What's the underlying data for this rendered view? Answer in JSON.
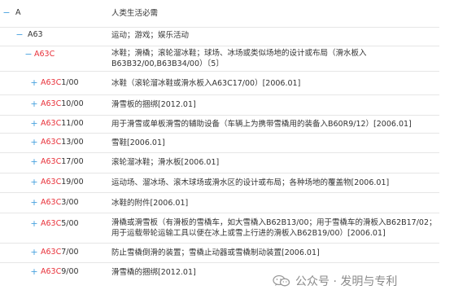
{
  "rows": [
    {
      "toggle": "−",
      "code_hl": "",
      "code_rest": "A",
      "desc": "人类生活必需"
    },
    {
      "toggle": "−",
      "code_hl": "",
      "code_rest": "A63",
      "desc": "运动；游戏；娱乐活动"
    },
    {
      "toggle": "−",
      "code_hl": "A63C",
      "code_rest": "",
      "desc": "冰鞋；滑橇；滚轮溜冰鞋；球场、冰场或类似场地的设计或布局（滑水板入B63B32/00,B63B34/00）〔5〕"
    },
    {
      "toggle": "+",
      "code_hl": "A63C",
      "code_rest": "1/00",
      "desc": "冰鞋（滚轮溜冰鞋或滑水板入A63C17/00）[2006.01]"
    },
    {
      "toggle": "+",
      "code_hl": "A63C",
      "code_rest": "10/00",
      "desc": "滑雪板的捆绑[2012.01]"
    },
    {
      "toggle": "+",
      "code_hl": "A63C",
      "code_rest": "11/00",
      "desc": "用于滑雪或单板滑雪的辅助设备（车辆上为携带雪橇用的装备入B60R9/12）[2006.01]"
    },
    {
      "toggle": "+",
      "code_hl": "A63C",
      "code_rest": "13/00",
      "desc": "雪鞋[2006.01]"
    },
    {
      "toggle": "+",
      "code_hl": "A63C",
      "code_rest": "17/00",
      "desc": "滚轮溜冰鞋；滑水板[2006.01]"
    },
    {
      "toggle": "+",
      "code_hl": "A63C",
      "code_rest": "19/00",
      "desc": "运动场、溜冰场、滚木球场或滑水区的设计或布局；各种场地的覆盖物[2006.01]"
    },
    {
      "toggle": "+",
      "code_hl": "A63C",
      "code_rest": "3/00",
      "desc": "冰鞋的附件[2006.01]"
    },
    {
      "toggle": "+",
      "code_hl": "A63C",
      "code_rest": "5/00",
      "desc": "滑橇或滑雪板（有滑板的雪橇车，如大雪橇入B62B13/00；用于雪橇车的滑板入B62B17/02；用于运载带轮运输工具以便在冰上或雪上行进的滑板入B62B19/00）[2006.01]"
    },
    {
      "toggle": "+",
      "code_hl": "A63C",
      "code_rest": "7/00",
      "desc": "防止雪橇倒滑的装置；雪橇止动器或雪橇制动装置[2006.01]"
    },
    {
      "toggle": "+",
      "code_hl": "A63C",
      "code_rest": "9/00",
      "desc": "滑雪橇的捆绑[2012.01]"
    }
  ],
  "watermark": {
    "text": "公众号 · 发明与专利",
    "icon": "wechat-icon"
  },
  "colors": {
    "accent": "#4aa3df",
    "highlight": "#e8313a",
    "text": "#333333",
    "divider": "#e6e6e6"
  }
}
